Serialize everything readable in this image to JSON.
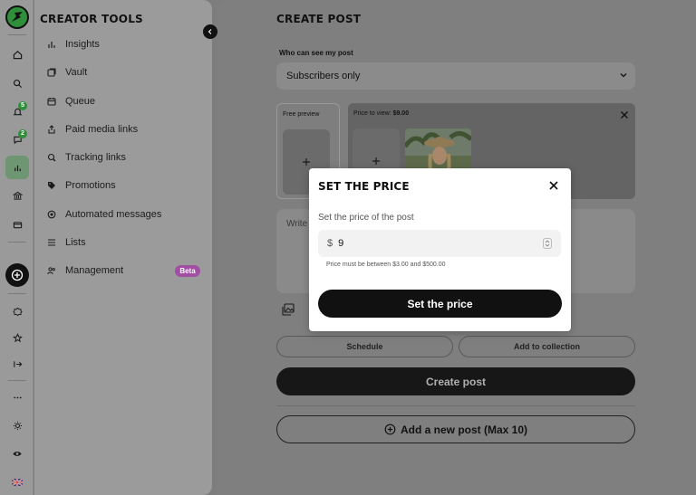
{
  "nav_rail": {
    "notifications_badge": "5",
    "messages_badge": "2"
  },
  "creator_tools": {
    "title": "CREATOR TOOLS",
    "items": [
      {
        "label": "Insights",
        "icon": "bar-chart-icon"
      },
      {
        "label": "Vault",
        "icon": "vault-icon"
      },
      {
        "label": "Queue",
        "icon": "calendar-icon"
      },
      {
        "label": "Paid media links",
        "icon": "share-icon"
      },
      {
        "label": "Tracking links",
        "icon": "tracking-link-icon"
      },
      {
        "label": "Promotions",
        "icon": "tag-icon"
      },
      {
        "label": "Automated messages",
        "icon": "auto-message-icon"
      },
      {
        "label": "Lists",
        "icon": "list-icon"
      },
      {
        "label": "Management",
        "icon": "team-icon"
      }
    ],
    "beta_badge": "Beta"
  },
  "create_post": {
    "title": "CREATE POST",
    "who_label": "Who can see my post",
    "audience_selected": "Subscribers only",
    "free_preview_label": "Free preview",
    "price_label": "Price to view:",
    "price_value": "$9.00",
    "write_placeholder": "Write",
    "schedule_label": "Schedule",
    "collection_label": "Add to collection",
    "create_label": "Create post",
    "add_post_label": "Add a new post (Max 10)"
  },
  "modal": {
    "title": "SET THE PRICE",
    "label": "Set the price of the post",
    "currency": "$",
    "price_input": "9",
    "hint": "Price must be between $3.00 and $500.00",
    "submit_label": "Set the price"
  },
  "colors": {
    "brand_green": "#2f8f3a",
    "beta_purple": "#a14fa3",
    "primary_dark": "#111111"
  }
}
